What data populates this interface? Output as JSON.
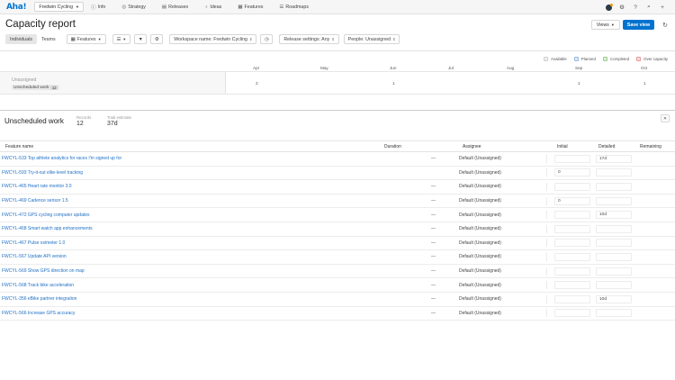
{
  "nav": {
    "logo": "Aha!",
    "workspace": "Fredwin Cycling",
    "items": [
      {
        "label": "Info",
        "icon": "ⓘ"
      },
      {
        "label": "Strategy",
        "icon": "◎"
      },
      {
        "label": "Releases",
        "icon": "▤"
      },
      {
        "label": "Ideas",
        "icon": "♁"
      },
      {
        "label": "Features",
        "icon": "▦"
      },
      {
        "label": "Roadmaps",
        "icon": "☰"
      }
    ]
  },
  "header": {
    "title": "Capacity report",
    "views_label": "Views",
    "save_label": "Save view"
  },
  "toolbar": {
    "tab_individuals": "Individuals",
    "tab_teams": "Teams",
    "features_label": "Features",
    "workspace_filter": "Workspace name: Fredwin Cycling",
    "release_filter": "Release settings: Any",
    "people_filter": "People: Unassigned"
  },
  "legend": [
    {
      "label": "Available",
      "color": "#f0f0f0",
      "border": "#cfcfcf"
    },
    {
      "label": "Planned",
      "color": "#dbe7f7",
      "border": "#9dbbe3"
    },
    {
      "label": "Completed",
      "color": "#dbeed3",
      "border": "#9fcf8d"
    },
    {
      "label": "Over capacity",
      "color": "#f9dcdc",
      "border": "#e79c9c"
    }
  ],
  "timeline": {
    "months": [
      "Apr",
      "May",
      "Jun",
      "Jul",
      "Aug",
      "Sep",
      "Oct"
    ],
    "row_name": "Unassigned",
    "row_tag": "Unscheduled work",
    "row_tag_count": "12",
    "values": [
      "2",
      "1",
      "1",
      "1"
    ]
  },
  "unscheduled": {
    "title": "Unscheduled work",
    "records_label": "Records",
    "records_value": "12",
    "total_label": "Total estimate",
    "total_value": "37d"
  },
  "table": {
    "headers": {
      "name": "Feature name",
      "duration": "Duration",
      "assignee": "Assignee",
      "initial": "Initial",
      "detailed": "Detailed",
      "remaining": "Remaining"
    },
    "rows": [
      {
        "name": "FWCYL-533 Top athlete analytics for races I'm signed up for",
        "duration": "—",
        "assignee": "Default (Unassigned)",
        "initial": "",
        "detailed": "17d",
        "remaining": ""
      },
      {
        "name": "FWCYL-593 Try-it-out elite-level tracking",
        "duration": "",
        "assignee": "Default (Unassigned)",
        "initial": "0",
        "detailed": "",
        "remaining": ""
      },
      {
        "name": "FWCYL-465 Heart rate monitor 3.0",
        "duration": "—",
        "assignee": "Default (Unassigned)",
        "initial": "",
        "detailed": "",
        "remaining": ""
      },
      {
        "name": "FWCYL-469 Cadence sensor 1.5",
        "duration": "—",
        "assignee": "Default (Unassigned)",
        "initial": "0",
        "detailed": "",
        "remaining": ""
      },
      {
        "name": "FWCYL-472 GPS cycling computer updates",
        "duration": "—",
        "assignee": "Default (Unassigned)",
        "initial": "",
        "detailed": "10d",
        "remaining": ""
      },
      {
        "name": "FWCYL-468 Smart watch app enhancements",
        "duration": "—",
        "assignee": "Default (Unassigned)",
        "initial": "",
        "detailed": "",
        "remaining": ""
      },
      {
        "name": "FWCYL-467 Pulse oximeter 1.0",
        "duration": "—",
        "assignee": "Default (Unassigned)",
        "initial": "",
        "detailed": "",
        "remaining": ""
      },
      {
        "name": "FWCYL-567 Update API version",
        "duration": "—",
        "assignee": "Default (Unassigned)",
        "initial": "",
        "detailed": "",
        "remaining": ""
      },
      {
        "name": "FWCYL-569 Show GPS direction on map",
        "duration": "—",
        "assignee": "Default (Unassigned)",
        "initial": "",
        "detailed": "",
        "remaining": ""
      },
      {
        "name": "FWCYL-568 Track bike acceleration",
        "duration": "—",
        "assignee": "Default (Unassigned)",
        "initial": "",
        "detailed": "",
        "remaining": ""
      },
      {
        "name": "FWCYL-356 eBike partner integration",
        "duration": "—",
        "assignee": "Default (Unassigned)",
        "initial": "",
        "detailed": "10d",
        "remaining": ""
      },
      {
        "name": "FWCYL-566 Increase GPS accuracy",
        "duration": "—",
        "assignee": "Default (Unassigned)",
        "initial": "",
        "detailed": "",
        "remaining": ""
      }
    ]
  }
}
